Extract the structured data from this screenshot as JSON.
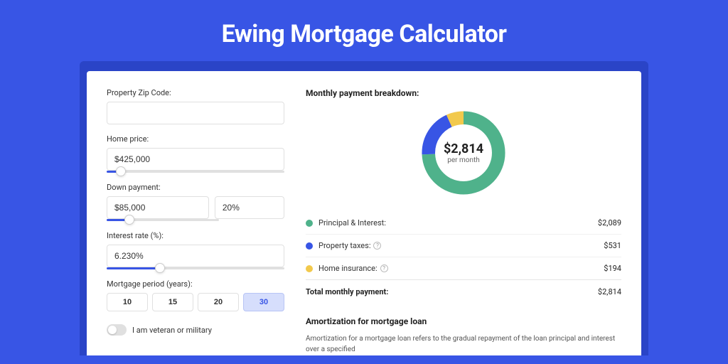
{
  "page": {
    "title": "Ewing Mortgage Calculator"
  },
  "form": {
    "zip_label": "Property Zip Code:",
    "zip_value": "",
    "home_price_label": "Home price:",
    "home_price_value": "$425,000",
    "down_payment_label": "Down payment:",
    "down_payment_value": "$85,000",
    "down_payment_pct": "20%",
    "interest_label": "Interest rate (%):",
    "interest_value": "6.230%",
    "period_label": "Mortgage period (years):",
    "period_options": [
      "10",
      "15",
      "20",
      "30"
    ],
    "period_selected": "30",
    "veteran_label": "I am veteran or military"
  },
  "sliders": {
    "home_price_pct": 8,
    "down_payment_pct": 20,
    "interest_pct": 30
  },
  "breakdown": {
    "title": "Monthly payment breakdown:",
    "center_value": "$2,814",
    "center_label": "per month",
    "items": [
      {
        "name": "Principal & Interest:",
        "value": "$2,089",
        "color": "#4fb28b",
        "has_help": false
      },
      {
        "name": "Property taxes:",
        "value": "$531",
        "color": "#3855e5",
        "has_help": true
      },
      {
        "name": "Home insurance:",
        "value": "$194",
        "color": "#f2c94c",
        "has_help": true
      }
    ],
    "total_label": "Total monthly payment:",
    "total_value": "$2,814"
  },
  "chart_data": {
    "type": "pie",
    "title": "Monthly payment breakdown",
    "series": [
      {
        "name": "Principal & Interest",
        "value": 2089,
        "color": "#4fb28b"
      },
      {
        "name": "Property taxes",
        "value": 531,
        "color": "#3855e5"
      },
      {
        "name": "Home insurance",
        "value": 194,
        "color": "#f2c94c"
      }
    ],
    "total": 2814,
    "center_label": "$2,814 per month"
  },
  "amortization": {
    "title": "Amortization for mortgage loan",
    "text": "Amortization for a mortgage loan refers to the gradual repayment of the loan principal and interest over a specified"
  }
}
